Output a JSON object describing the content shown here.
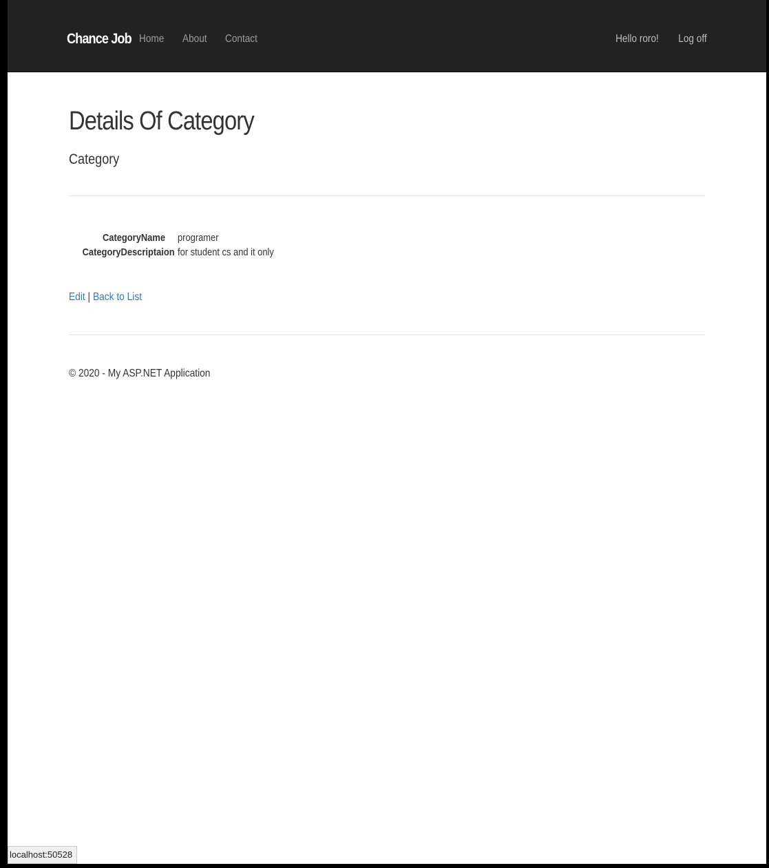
{
  "navbar": {
    "brand": "Chance Job",
    "links": [
      "Home",
      "About",
      "Contact"
    ],
    "greeting": "Hello roro!",
    "logoff": "Log off"
  },
  "main": {
    "title": "Details Of Category",
    "subtitle": "Category",
    "details": [
      {
        "label": "CategoryName",
        "value": "programer"
      },
      {
        "label": "CategoryDescriptaion",
        "value": "for student cs and it only"
      }
    ],
    "edit_link": "Edit",
    "separator": " | ",
    "back_link": "Back to List"
  },
  "footer": {
    "text": "© 2020 - My ASP.NET Application"
  },
  "statusbar": {
    "url": "localhost:50528"
  },
  "colors": {
    "navbar_bg": "#222222",
    "link": "#337ab7",
    "text": "#333333"
  }
}
